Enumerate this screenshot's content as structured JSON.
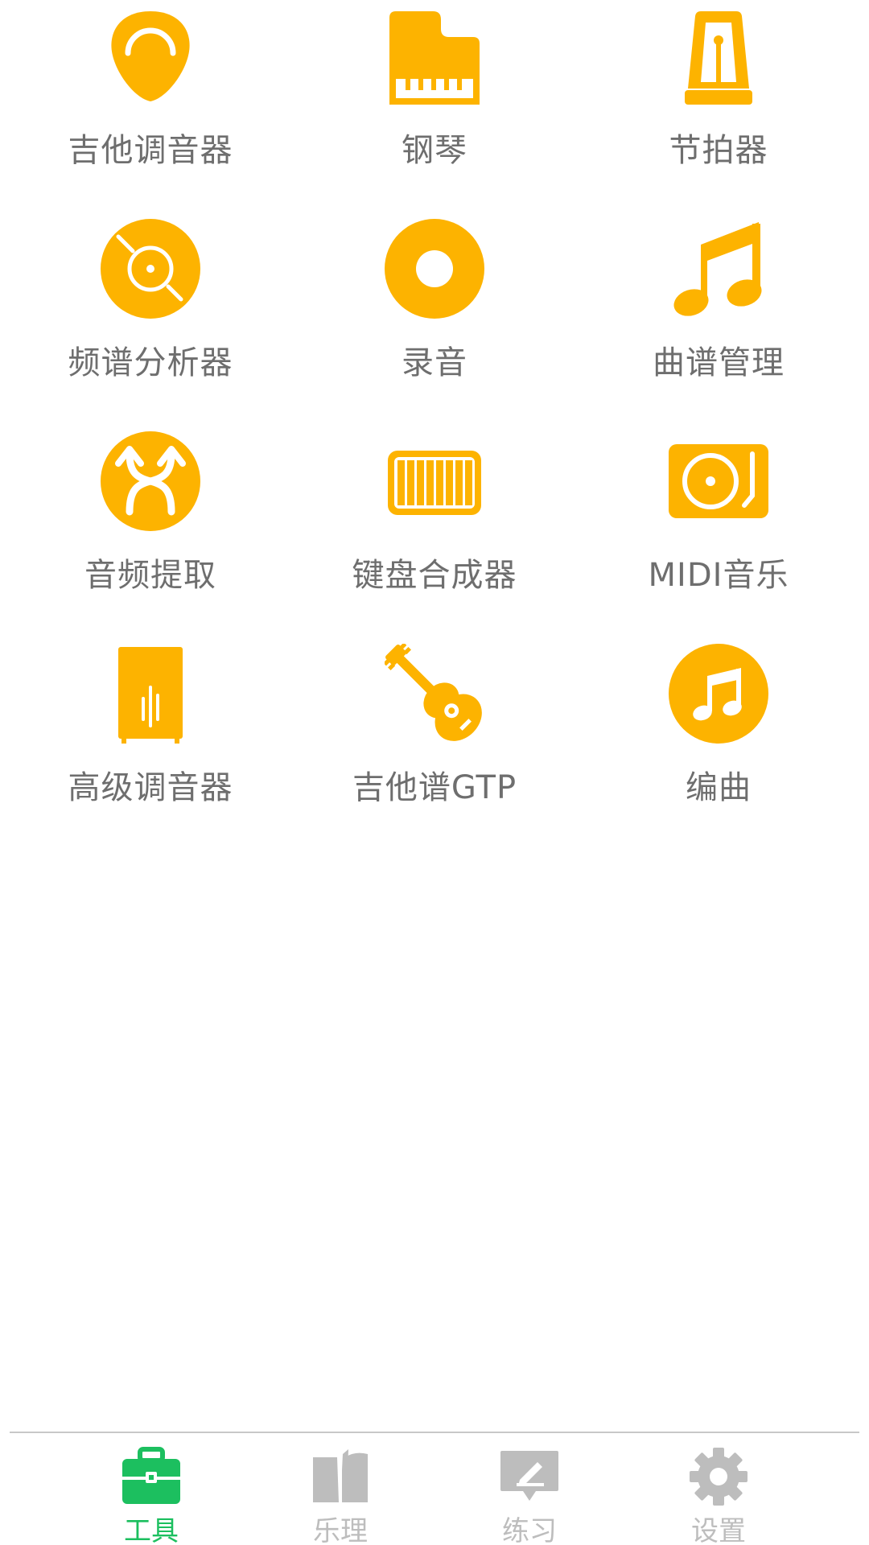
{
  "colors": {
    "icon_accent": "#FDB300",
    "label_text": "#6E6E6E",
    "nav_active": "#1CBF5F",
    "nav_inactive": "#BDBDBD"
  },
  "tools": [
    {
      "label": "吉他调音器",
      "icon": "guitar-pick-icon"
    },
    {
      "label": "钢琴",
      "icon": "piano-icon"
    },
    {
      "label": "节拍器",
      "icon": "metronome-icon"
    },
    {
      "label": "频谱分析器",
      "icon": "spectrum-disc-icon"
    },
    {
      "label": "录音",
      "icon": "record-disc-icon"
    },
    {
      "label": "曲谱管理",
      "icon": "music-note-icon"
    },
    {
      "label": "音频提取",
      "icon": "audio-extract-icon"
    },
    {
      "label": "键盘合成器",
      "icon": "keyboard-synth-icon"
    },
    {
      "label": "MIDI音乐",
      "icon": "turntable-icon"
    },
    {
      "label": "高级调音器",
      "icon": "cabinet-tuner-icon"
    },
    {
      "label": "吉他谱GTP",
      "icon": "guitar-icon"
    },
    {
      "label": "编曲",
      "icon": "music-note-circle-icon"
    }
  ],
  "bottom_nav": {
    "active_index": 0,
    "items": [
      {
        "label": "工具",
        "icon": "toolbox-icon"
      },
      {
        "label": "乐理",
        "icon": "book-icon"
      },
      {
        "label": "练习",
        "icon": "pencil-board-icon"
      },
      {
        "label": "设置",
        "icon": "gear-icon"
      }
    ]
  }
}
